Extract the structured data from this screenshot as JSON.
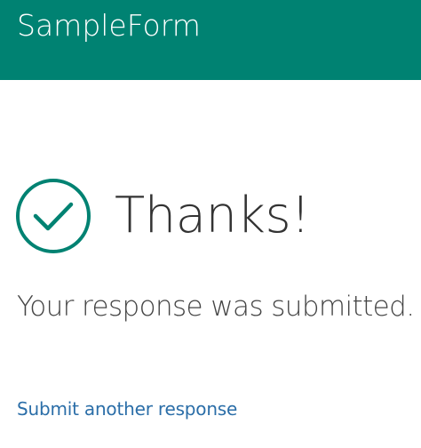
{
  "header": {
    "title": "SampleForm"
  },
  "confirmation": {
    "icon": "checkmark-circle-icon",
    "heading": "Thanks!",
    "message": "Your response was submitted."
  },
  "actions": {
    "submit_another_label": "Submit another response"
  },
  "colors": {
    "header_background": "#008272",
    "icon_color": "#008272",
    "link_color": "#2b6ea8"
  }
}
